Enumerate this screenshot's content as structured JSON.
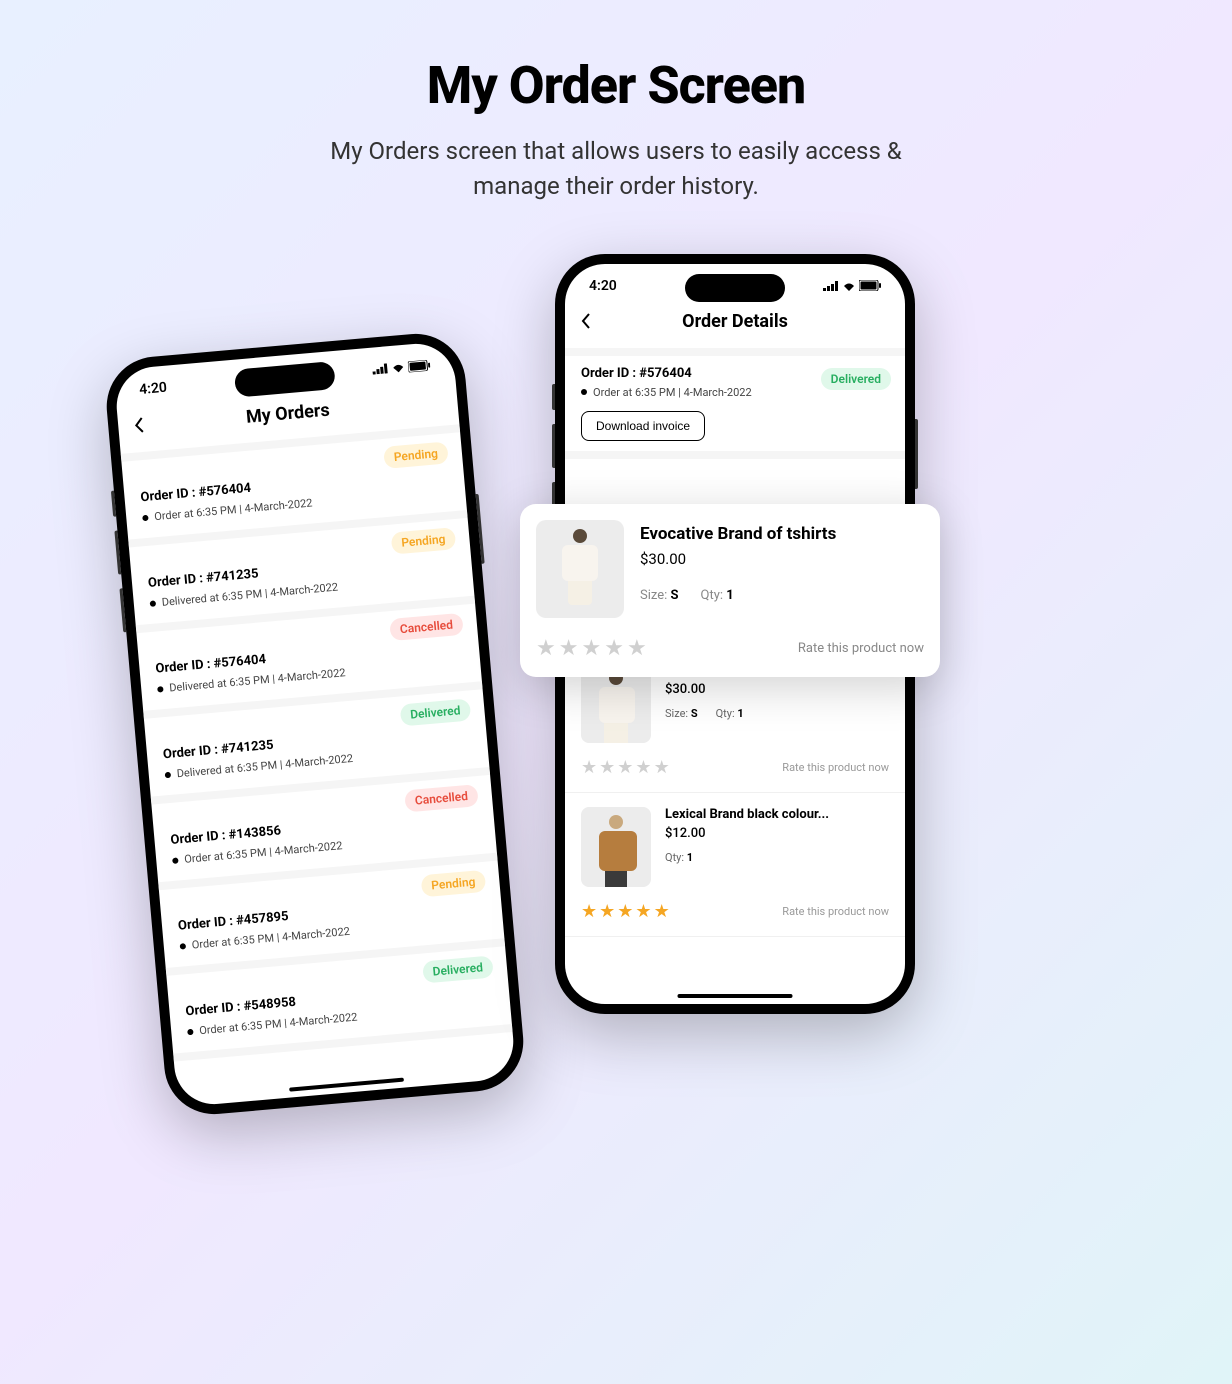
{
  "header": {
    "title": "My Order Screen",
    "subtitle_line1": "My Orders screen that allows users to easily access &",
    "subtitle_line2": "manage their order history."
  },
  "status_bar": {
    "time": "4:20"
  },
  "screen1": {
    "title": "My Orders",
    "orders": [
      {
        "id": "Order ID : #576404",
        "time": "Order at 6:35 PM | 4-March-2022",
        "status": "Pending",
        "status_class": "badge-pending"
      },
      {
        "id": "Order ID : #741235",
        "time": "Delivered at 6:35 PM | 4-March-2022",
        "status": "Pending",
        "status_class": "badge-pending"
      },
      {
        "id": "Order ID : #576404",
        "time": "Delivered at 6:35 PM | 4-March-2022",
        "status": "Cancelled",
        "status_class": "badge-cancelled"
      },
      {
        "id": "Order ID : #741235",
        "time": "Delivered at 6:35 PM | 4-March-2022",
        "status": "Delivered",
        "status_class": "badge-delivered"
      },
      {
        "id": "Order ID : #143856",
        "time": "Order at 6:35 PM | 4-March-2022",
        "status": "Cancelled",
        "status_class": "badge-cancelled"
      },
      {
        "id": "Order ID : #457895",
        "time": "Order at 6:35 PM | 4-March-2022",
        "status": "Pending",
        "status_class": "badge-pending"
      },
      {
        "id": "Order ID : #548958",
        "time": "Order at 6:35 PM | 4-March-2022",
        "status": "Delivered",
        "status_class": "badge-delivered"
      }
    ]
  },
  "screen2": {
    "title": "Order Details",
    "order_id": "Order ID : #576404",
    "order_time": "Order at 6:35 PM | 4-March-2022",
    "status": "Delivered",
    "download_label": "Download invoice",
    "products": [
      {
        "title": "Evocative Brand of tshirts",
        "price": "$30.00",
        "size_label": "Size:",
        "size": "S",
        "qty_label": "Qty:",
        "qty": "1",
        "rate_label": "Rate this product now",
        "filled": 0,
        "silhouette": "sil-white"
      },
      {
        "title": "Lexical Brand black colour...",
        "price": "$12.00",
        "size_label": "",
        "size": "",
        "qty_label": "Qty:",
        "qty": "1",
        "rate_label": "Rate this product now",
        "filled": 5,
        "silhouette": "sil-brown"
      }
    ]
  },
  "popup": {
    "title": "Evocative Brand of tshirts",
    "price": "$30.00",
    "size_label": "Size:",
    "size": "S",
    "qty_label": "Qty:",
    "qty": "1",
    "rate_label": "Rate this product now"
  }
}
